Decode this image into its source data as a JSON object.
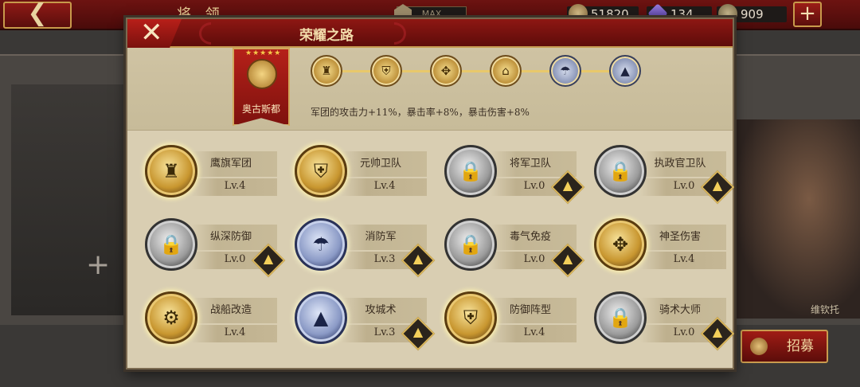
{
  "background": {
    "back_icon": "back-arrow-icon",
    "screen_title": "将 领",
    "building_level": "MAX",
    "resources": {
      "coins": "51820",
      "gems": "134",
      "laurels": "909"
    },
    "plus_label": "+",
    "recruit_label": "招募",
    "empty_slot_label": "+",
    "hero_name": "维钦托"
  },
  "dialog": {
    "title": "荣耀之路",
    "close_label": "✕",
    "faction": {
      "name": "奥古斯都",
      "stars": "★★★★★"
    },
    "progress_nodes": [
      {
        "icon": "eagle-banner-icon",
        "glyph": "♜",
        "style": "gold"
      },
      {
        "icon": "shield-crest-icon",
        "glyph": "⛨",
        "style": "gold"
      },
      {
        "icon": "sacred-cross-icon",
        "glyph": "✥",
        "style": "gold"
      },
      {
        "icon": "marshal-guard-icon",
        "glyph": "⌂",
        "style": "gold"
      },
      {
        "icon": "fire-brigade-icon",
        "glyph": "☂",
        "style": "silver"
      },
      {
        "icon": "siege-tower-icon",
        "glyph": "▲",
        "style": "silver"
      }
    ],
    "bonus_text": "军团的攻击力+11%，暴击率+8%，暴击伤害+8%",
    "skills": [
      {
        "name": "鹰旗军团",
        "level": "Lv.4",
        "medal": "gold",
        "icon": "eagle-standard-icon",
        "glyph": "♜",
        "upgradable": false
      },
      {
        "name": "元帅卫队",
        "level": "Lv.4",
        "medal": "gold",
        "icon": "marshal-shield-icon",
        "glyph": "⛨",
        "upgradable": false
      },
      {
        "name": "将军卫队",
        "level": "Lv.0",
        "medal": "silver",
        "icon": "locked-shield-icon",
        "glyph": "🔒",
        "upgradable": true
      },
      {
        "name": "执政官卫队",
        "level": "Lv.0",
        "medal": "silver",
        "icon": "locked-shield-icon",
        "glyph": "🔒",
        "upgradable": true
      },
      {
        "name": "纵深防御",
        "level": "Lv.0",
        "medal": "silver",
        "icon": "locked-wall-icon",
        "glyph": "🔒",
        "upgradable": true
      },
      {
        "name": "消防军",
        "level": "Lv.3",
        "medal": "blue",
        "icon": "fire-hose-icon",
        "glyph": "☂",
        "upgradable": true
      },
      {
        "name": "毒气免疫",
        "level": "Lv.0",
        "medal": "silver",
        "icon": "locked-mask-icon",
        "glyph": "🔒",
        "upgradable": true
      },
      {
        "name": "神圣伤害",
        "level": "Lv.4",
        "medal": "gold",
        "icon": "sacred-cross-icon",
        "glyph": "✥",
        "upgradable": false
      },
      {
        "name": "战船改造",
        "level": "Lv.4",
        "medal": "gold",
        "icon": "warship-gear-icon",
        "glyph": "⚙",
        "upgradable": false
      },
      {
        "name": "攻城术",
        "level": "Lv.3",
        "medal": "blue",
        "icon": "siege-tower-icon",
        "glyph": "▲",
        "upgradable": true
      },
      {
        "name": "防御阵型",
        "level": "Lv.4",
        "medal": "gold",
        "icon": "triple-shield-icon",
        "glyph": "⛨",
        "upgradable": false
      },
      {
        "name": "骑术大师",
        "level": "Lv.0",
        "medal": "silver",
        "icon": "locked-horse-icon",
        "glyph": "🔒",
        "upgradable": true
      }
    ],
    "upgrade_icon": "upgrade-arrow-icon",
    "upgrade_glyph": "⮝"
  },
  "colors": {
    "header_red": "#8e1713",
    "dialog_bg": "#d9ceb2",
    "gold": "#c8962f",
    "silver": "#9b9b9b",
    "blue": "#8b9ac6"
  }
}
